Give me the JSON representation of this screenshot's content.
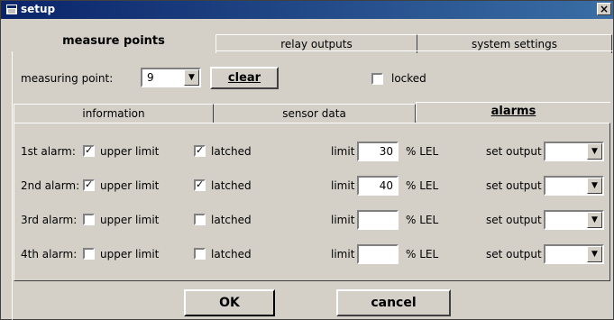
{
  "window": {
    "title": "setup",
    "close_glyph": "×"
  },
  "outer_tabs": [
    "measure points",
    "relay outputs",
    "system settings"
  ],
  "measuring_point": {
    "label": "measuring point:",
    "value": "9"
  },
  "clear_label": "clear",
  "locked": {
    "label": "locked",
    "checked": false
  },
  "inner_tabs": [
    "information",
    "sensor data",
    "alarms"
  ],
  "alarms": [
    {
      "label": "1st alarm:",
      "upper_limit_label": "upper limit",
      "upper_limit": true,
      "latched_label": "latched",
      "latched": true,
      "limit_label": "limit",
      "limit": "30",
      "unit": "% LEL",
      "set_output_label": "set output"
    },
    {
      "label": "2nd alarm:",
      "upper_limit_label": "upper limit",
      "upper_limit": true,
      "latched_label": "latched",
      "latched": true,
      "limit_label": "limit",
      "limit": "40",
      "unit": "% LEL",
      "set_output_label": "set output"
    },
    {
      "label": "3rd alarm:",
      "upper_limit_label": "upper limit",
      "upper_limit": false,
      "latched_label": "latched",
      "latched": false,
      "limit_label": "limit",
      "limit": "",
      "unit": "% LEL",
      "set_output_label": "set output"
    },
    {
      "label": "4th alarm:",
      "upper_limit_label": "upper limit",
      "upper_limit": false,
      "latched_label": "latched",
      "latched": false,
      "limit_label": "limit",
      "limit": "",
      "unit": "% LEL",
      "set_output_label": "set output"
    }
  ],
  "buttons": {
    "ok": "OK",
    "cancel": "cancel"
  },
  "icons": {
    "combo_arrow": "▼",
    "check": "✓"
  },
  "colors": {
    "titlebar": "#0a246a",
    "face": "#d4d0c8"
  }
}
